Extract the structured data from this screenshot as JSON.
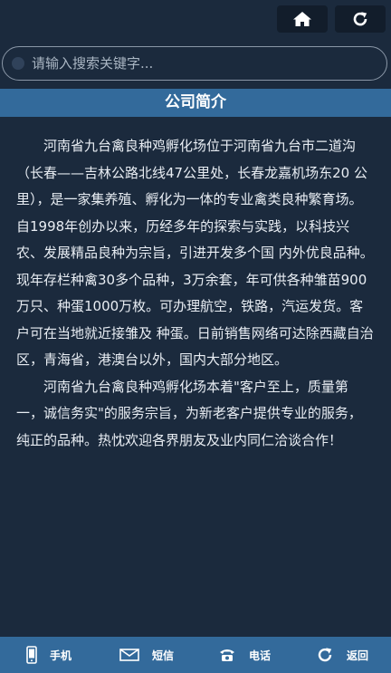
{
  "topbar": {
    "home_icon": "home-icon",
    "refresh_icon": "refresh-icon"
  },
  "search": {
    "placeholder": "请输入搜索关键字..."
  },
  "section": {
    "title": "公司简介"
  },
  "content": {
    "paragraphs": [
      "河南省九台禽良种鸡孵化场位于河南省九台市二道沟（长春——吉林公路北线47公里处，长春龙嘉机场东20 公里），是一家集养殖、孵化为一体的专业禽类良种繁育场。自1998年创办以来，历经多年的探索与实践，以科技兴农、发展精品良种为宗旨，引进开发多个国 内外优良品种。现年存栏种禽30多个品种，3万余套，年可供各种雏苗900万只、种蛋1000万枚。可办理航空，铁路，汽运发货。客户可在当地就近接雏及 种蛋。日前销售网络可达除西藏自治区，青海省，港澳台以外，国内大部分地区。",
      "河南省九台禽良种鸡孵化场本着\"客户至上，质量第一，诚信务实\"的服务宗旨，为新老客户提供专业的服务，纯正的品种。热忱欢迎各界朋友及业内同仁洽谈合作！"
    ]
  },
  "bottom_nav": {
    "items": [
      {
        "label": "手机",
        "icon": "mobile-phone-icon"
      },
      {
        "label": "短信",
        "icon": "envelope-icon"
      },
      {
        "label": "电话",
        "icon": "telephone-icon"
      },
      {
        "label": "返回",
        "icon": "back-arrow-icon"
      }
    ]
  },
  "colors": {
    "background": "#1b2a3d",
    "accent": "#336a9b",
    "button_bg": "#121d2b",
    "text": "#e8edf3"
  }
}
